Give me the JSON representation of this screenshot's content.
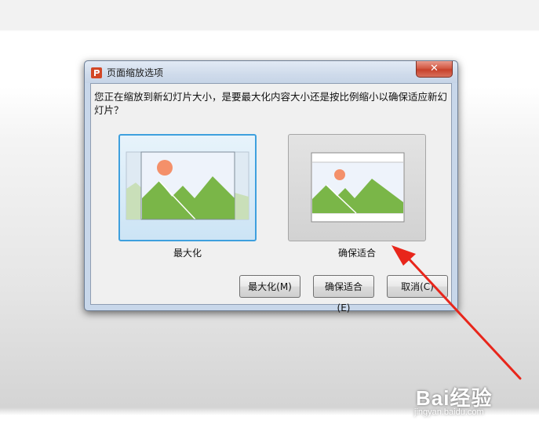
{
  "dialog": {
    "title": "页面缩放选项",
    "close_label": "✕",
    "prompt": "您正在缩放到新幻灯片大小，是要最大化内容大小还是按比例缩小以确保适应新幻灯片？",
    "options": [
      {
        "label": "最大化",
        "selected": true
      },
      {
        "label": "确保适合",
        "selected": false
      }
    ],
    "buttons": {
      "maximize": "最大化(M)",
      "ensure_fit": "确保适合(E)",
      "cancel": "取消(C)"
    }
  },
  "colors": {
    "accent": "#3ea0de",
    "close": "#c7412b",
    "app_icon": "#d24726",
    "sun": "#f4906a",
    "mountain": "#7ab648",
    "arrow": "#e8261b"
  },
  "icons": {
    "app": "powerpoint-p-icon",
    "image": "landscape-picture-icon"
  },
  "watermark": {
    "main": "Bai经验",
    "sub": "jingyan.baidu.com"
  }
}
